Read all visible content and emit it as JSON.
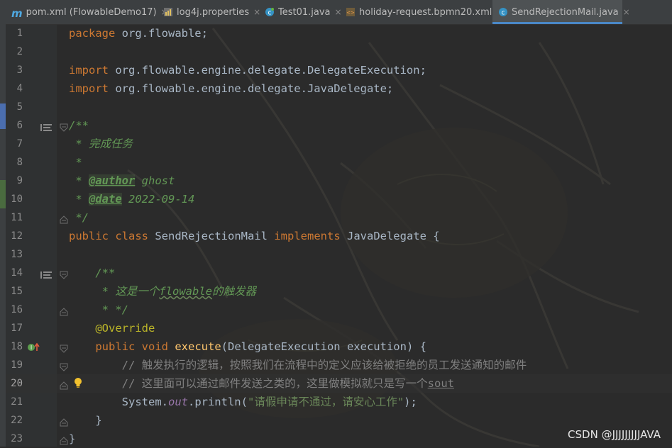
{
  "tabs": [
    {
      "label": "pom.xml (FlowableDemo17)",
      "icon": "maven-icon",
      "active": false
    },
    {
      "label": "log4j.properties",
      "icon": "properties-file-icon",
      "active": false
    },
    {
      "label": "Test01.java",
      "icon": "java-class-icon",
      "active": false
    },
    {
      "label": "holiday-request.bpmn20.xml",
      "icon": "xml-file-icon",
      "active": false
    },
    {
      "label": "SendRejectionMail.java",
      "icon": "java-class-icon",
      "active": true
    }
  ],
  "tab_close_glyph": "×",
  "maven_glyph": "m",
  "editor": {
    "current_line": "20",
    "lines": [
      {
        "n": "1",
        "t": {
          "kw1": "package",
          "rest": " org.flowable;"
        }
      },
      {
        "n": "2",
        "t": {}
      },
      {
        "n": "3",
        "t": {
          "kw1": "import",
          "rest": " org.flowable.engine.delegate.DelegateExecution;"
        }
      },
      {
        "n": "4",
        "t": {
          "kw1": "import",
          "rest": " org.flowable.engine.delegate.JavaDelegate;"
        }
      },
      {
        "n": "5",
        "t": {}
      },
      {
        "n": "6",
        "t": {
          "c1": "/**"
        }
      },
      {
        "n": "7",
        "t": {
          "c1": " * 完成任务"
        }
      },
      {
        "n": "8",
        "t": {
          "c1": " *"
        }
      },
      {
        "n": "9",
        "t": {
          "c1": " * ",
          "tag": "@author",
          "c2": " ghost"
        }
      },
      {
        "n": "10",
        "t": {
          "c1": " * ",
          "tag": "@date",
          "c2": " 2022-09-14"
        }
      },
      {
        "n": "11",
        "t": {
          "c1": " */"
        }
      },
      {
        "n": "12",
        "t": {
          "kw1": "public",
          "sp1": " ",
          "kw2": "class",
          "plain": " SendRejectionMail ",
          "kw3": "implements",
          "rest": " JavaDelegate {"
        }
      },
      {
        "n": "13",
        "t": {}
      },
      {
        "n": "14",
        "t": {
          "c1": "    /**"
        }
      },
      {
        "n": "15",
        "t": {
          "c1": "     * 这是一个",
          "typo": "flowable",
          "c2": "的触发器"
        }
      },
      {
        "n": "16",
        "t": {
          "c1": "     * */"
        }
      },
      {
        "n": "17",
        "t": {
          "pre": "    ",
          "an": "@Override"
        }
      },
      {
        "n": "18",
        "t": {
          "pre": "    ",
          "kw1": "public",
          "sp1": " ",
          "kw2": "void",
          "sp2": " ",
          "fn": "execute",
          "rest": "(DelegateExecution execution) {"
        }
      },
      {
        "n": "19",
        "t": {
          "lc": "        // 触发执行的逻辑，按照我们在流程中的定义应该给被拒绝的员工发送通知的邮件"
        }
      },
      {
        "n": "20",
        "t": {
          "lc": "        // 这里面可以通过邮件发送之类的，这里做模拟就只是写一个",
          "lctypo": "sout"
        }
      },
      {
        "n": "21",
        "t": {
          "pre": "        System.",
          "sf": "out",
          "mid": ".println(",
          "st": "\"请假申请不通过，请安心工作\"",
          "rest": ");"
        }
      },
      {
        "n": "22",
        "t": {
          "rest": "    }"
        }
      },
      {
        "n": "23",
        "t": {
          "rest": "}"
        }
      }
    ]
  },
  "gutter_icons": {
    "line6": "doc-comment-render-icon",
    "line14": "doc-comment-render-icon",
    "line18": "implements-method-icon",
    "line20": "lightbulb-icon"
  },
  "watermark": "CSDN @JJJJJJJJJAVA",
  "colors": {
    "background": "#2b2b2b",
    "tabbar": "#3c3f41",
    "active_tab_underline": "#4a88c7",
    "keyword": "#cc7832",
    "doc_comment": "#629755",
    "line_comment": "#808080",
    "function": "#ffc66d",
    "annotation": "#bbb529",
    "string": "#6a8759",
    "static_field": "#9876aa",
    "default_text": "#a9b7c6"
  }
}
